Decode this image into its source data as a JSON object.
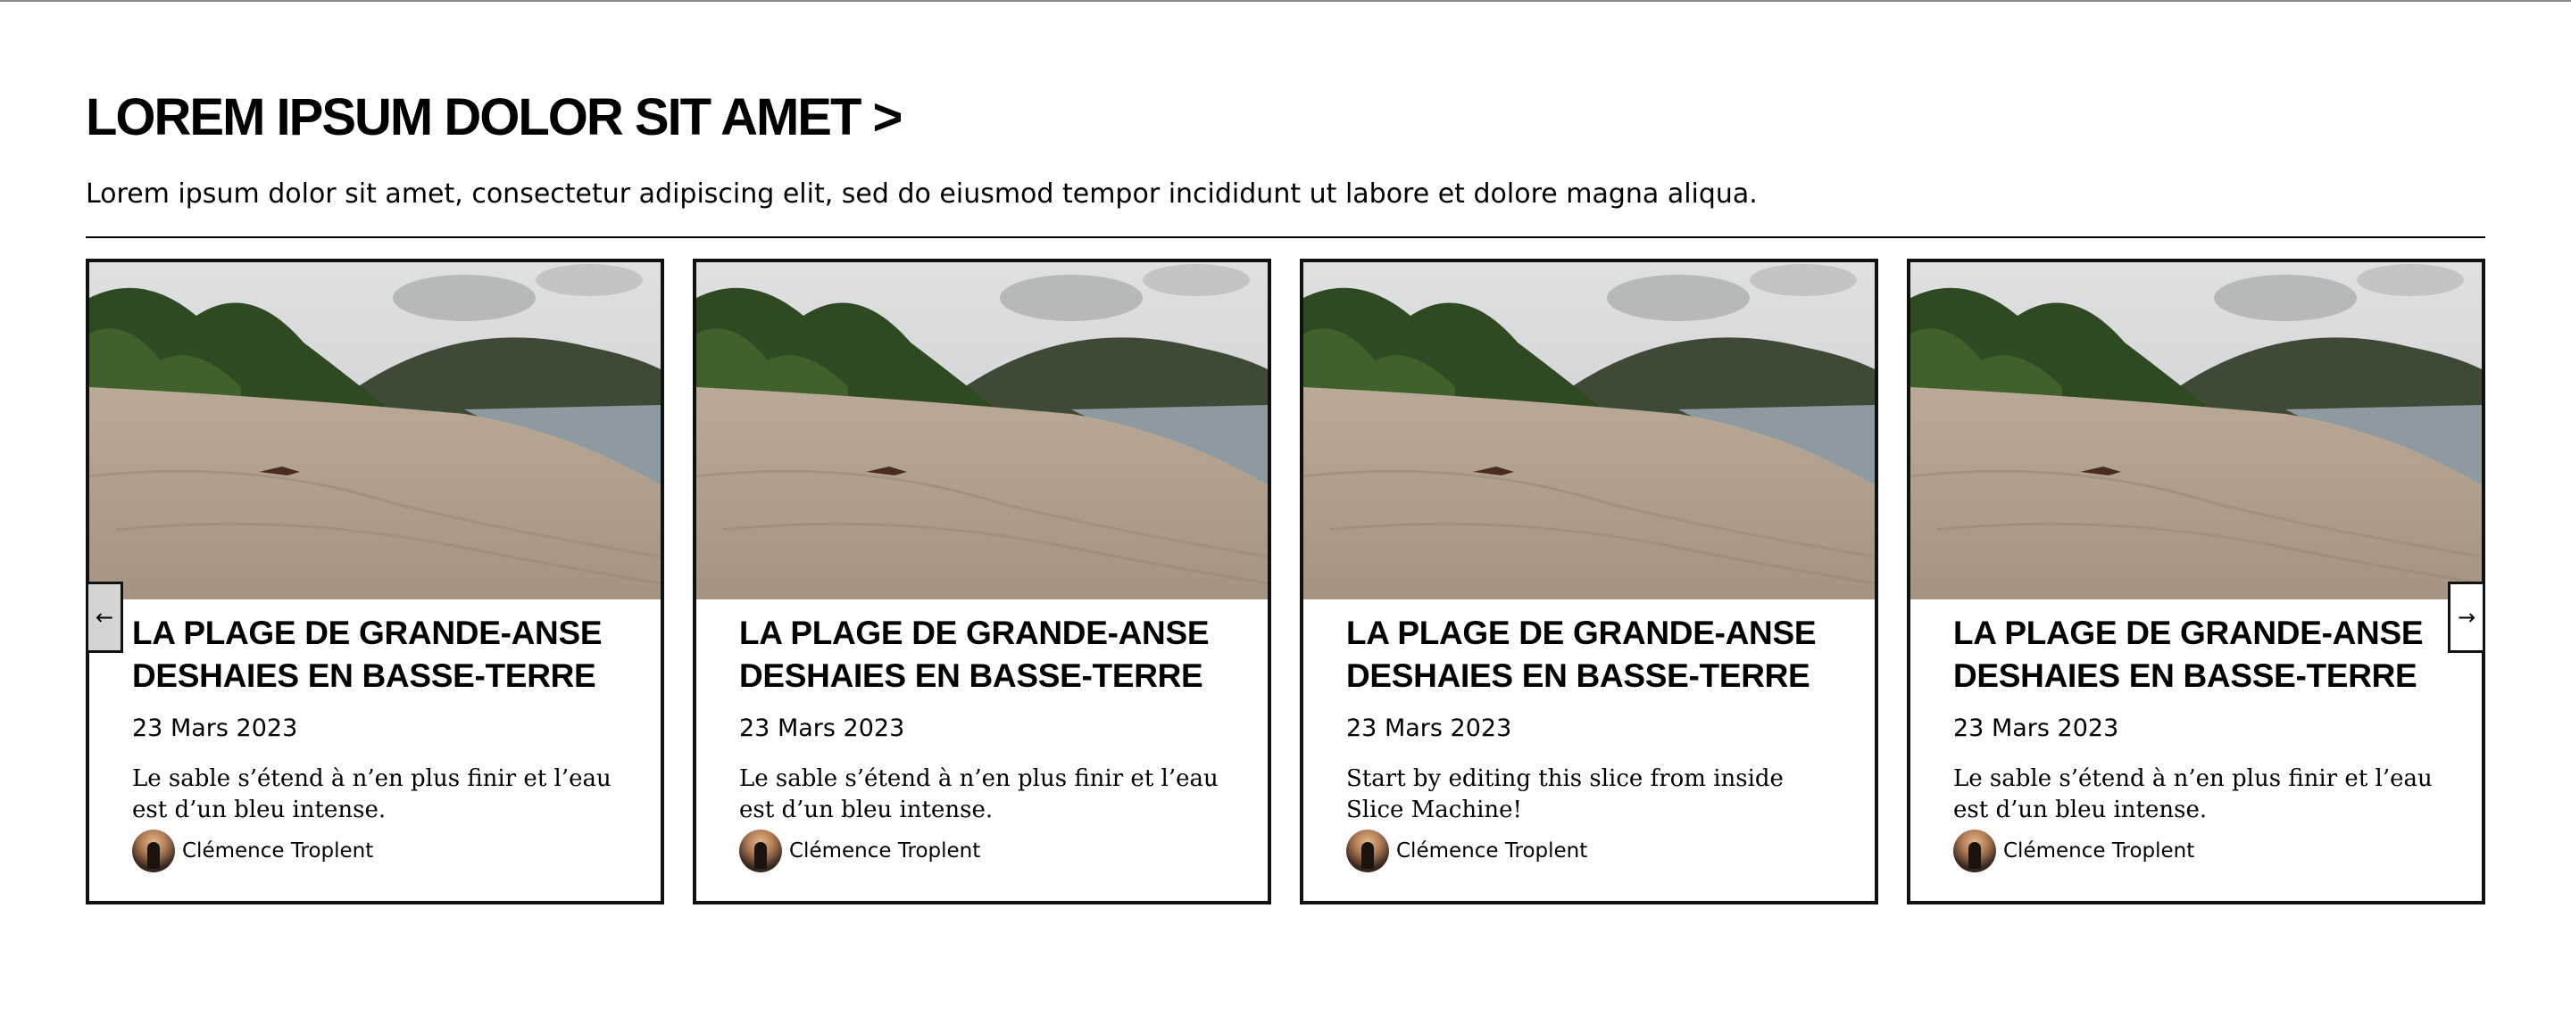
{
  "section": {
    "heading": "LOREM IPSUM DOLOR SIT AMET >",
    "intro": "Lorem ipsum dolor sit amet, consectetur adipiscing elit, sed do eiusmod tempor incididunt ut labore et dolore magna aliqua."
  },
  "carousel": {
    "prev_icon": "←",
    "next_icon": "→",
    "cards": [
      {
        "title": "LA PLAGE DE GRANDE-ANSE DESHAIES EN BASSE-TERRE",
        "date": "23 Mars 2023",
        "description": "Le sable s’étend à n’en plus finir et l’eau est d’un bleu intense.",
        "author": "Clémence Troplent"
      },
      {
        "title": "LA PLAGE DE GRANDE-ANSE DESHAIES EN BASSE-TERRE",
        "date": "23 Mars 2023",
        "description": "Le sable s’étend à n’en plus finir et l’eau est d’un bleu intense.",
        "author": "Clémence Troplent"
      },
      {
        "title": "LA PLAGE DE GRANDE-ANSE DESHAIES EN BASSE-TERRE",
        "date": "23 Mars 2023",
        "description": "Start by editing this slice from inside Slice Machine!",
        "author": "Clémence Troplent"
      },
      {
        "title": "LA PLAGE DE GRANDE-ANSE DESHAIES EN BASSE-TERRE",
        "date": "23 Mars 2023",
        "description": "Le sable s’étend à n’en plus finir et l’eau est d’un bleu intense.",
        "author": "Clémence Troplent"
      }
    ]
  },
  "colors": {
    "text": "#000000",
    "border": "#111111",
    "prev_button_bg": "#d4d4d4"
  }
}
